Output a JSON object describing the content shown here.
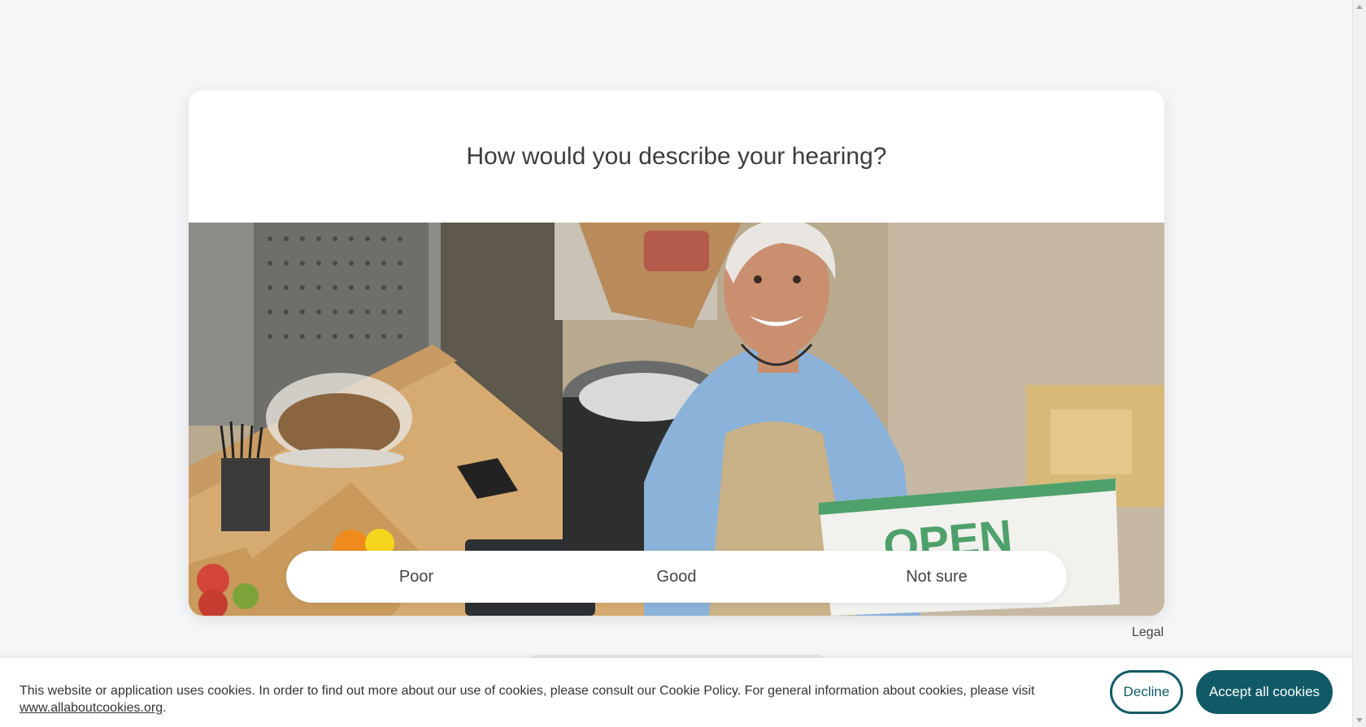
{
  "survey": {
    "question": "How would you describe your hearing?",
    "answers": [
      "Poor",
      "Good",
      "Not sure"
    ],
    "sign_text": "OPEN"
  },
  "footer": {
    "legal_label": "Legal"
  },
  "cookie_banner": {
    "message": "This website or application uses cookies. In order to find out more about our use of cookies, please consult our Cookie Policy. For general information about cookies, please visit ",
    "link_text": "www.allaboutcookies.org",
    "suffix": ".",
    "decline_label": "Decline",
    "accept_label": "Accept all cookies"
  },
  "colors": {
    "accent": "#0f5a66",
    "background": "#f5f6f7"
  }
}
